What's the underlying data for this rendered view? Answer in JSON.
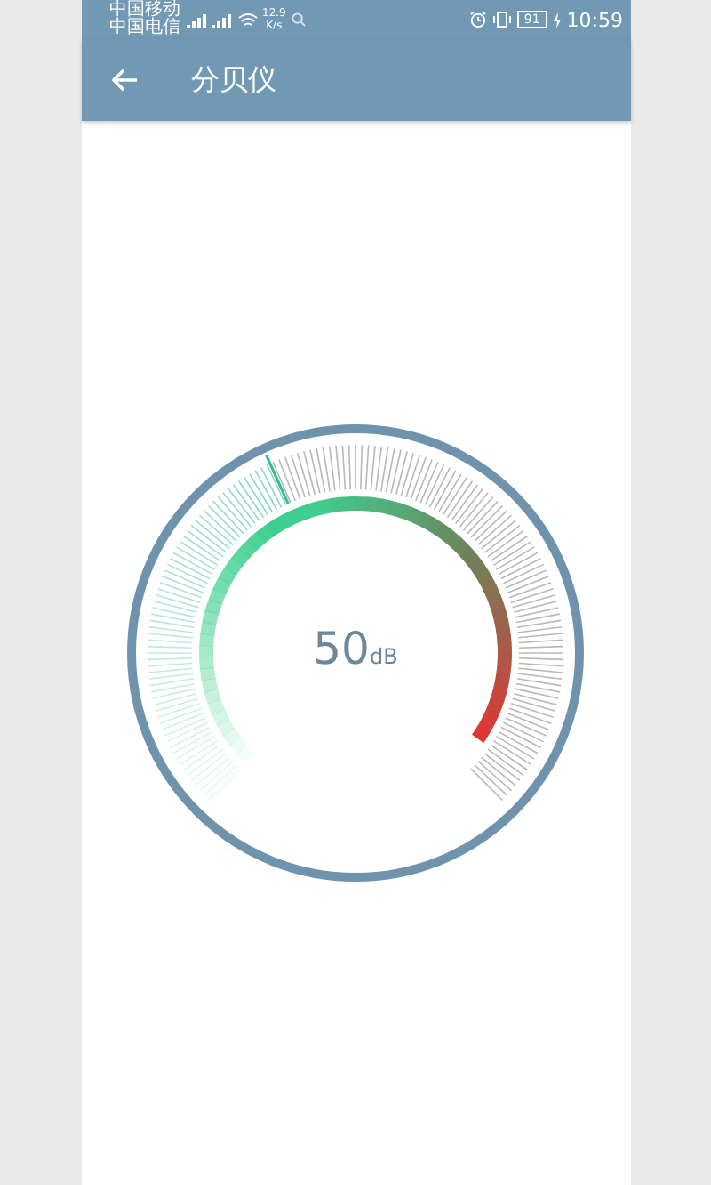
{
  "status_bar": {
    "carriers": [
      "中国移动",
      "中国电信"
    ],
    "speed": "12.9",
    "speed_unit": "K/s",
    "battery": "91",
    "time": "10:59"
  },
  "toolbar": {
    "title": "分贝仪"
  },
  "meter": {
    "value": "50",
    "unit": "dB"
  }
}
